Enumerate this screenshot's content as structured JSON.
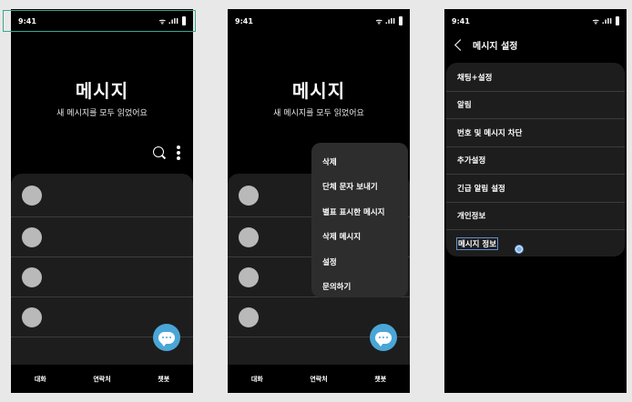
{
  "status_bar": {
    "time": "9:41",
    "signal": "ᯤ .ıll"
  },
  "screen1": {
    "title": "메시지",
    "subtitle": "새 메시지를 모두 읽었어요",
    "icons": [
      "search-icon",
      "more-vert-icon",
      "chat-icon"
    ],
    "conversation_count": 4
  },
  "nav": {
    "items": [
      "대화",
      "연락처",
      "챗봇"
    ]
  },
  "overflow_menu": {
    "items": [
      "삭제",
      "단체 문자 보내기",
      "별표 표시한 메시지",
      "삭제 메시지",
      "설정",
      "문의하기"
    ]
  },
  "settings": {
    "title": "메시지 설정",
    "items": [
      "채팅+설정",
      "알림",
      "번호 및 메시지 차단",
      "추가설정",
      "긴급 알림 설정",
      "개인정보",
      "메시지 정보"
    ]
  },
  "colors": {
    "background": "#000000",
    "card": "#1d1d1d",
    "menu": "#2d2d2d",
    "fab": "#4aa6d6",
    "selection": "#3aa78f"
  }
}
